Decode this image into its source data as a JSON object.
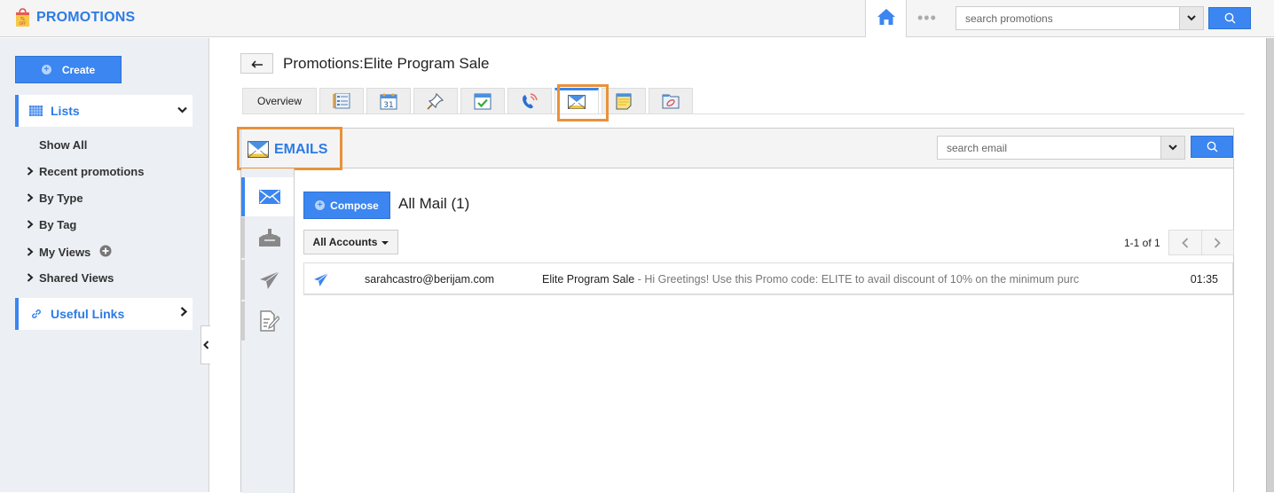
{
  "app": {
    "title": "PROMOTIONS",
    "icon": "shopping-bag-icon",
    "brand_color": "#2d7be5"
  },
  "topbar": {
    "home_icon": "home-icon",
    "more_icon": "more-dots-icon",
    "search_placeholder": "search promotions",
    "search_icon": "search-icon"
  },
  "sidebar": {
    "create_label": "Create",
    "lists_label": "Lists",
    "items": [
      {
        "label": "Show All",
        "has_arrow": false
      },
      {
        "label": "Recent promotions",
        "has_arrow": true
      },
      {
        "label": "By Type",
        "has_arrow": true
      },
      {
        "label": "By Tag",
        "has_arrow": true
      },
      {
        "label": "My Views",
        "has_arrow": true,
        "has_add": true
      },
      {
        "label": "Shared Views",
        "has_arrow": true
      }
    ],
    "useful_links_label": "Useful Links"
  },
  "header": {
    "back_icon": "back-arrow-icon",
    "title": "Promotions:Elite Program Sale"
  },
  "tabs": [
    {
      "label": "Overview",
      "icon": null
    },
    {
      "label": "",
      "icon": "details-icon"
    },
    {
      "label": "",
      "icon": "calendar-icon",
      "text": "31"
    },
    {
      "label": "",
      "icon": "pin-icon"
    },
    {
      "label": "",
      "icon": "task-check-icon"
    },
    {
      "label": "",
      "icon": "phone-call-icon"
    },
    {
      "label": "",
      "icon": "email-icon",
      "active": true
    },
    {
      "label": "",
      "icon": "notes-icon"
    },
    {
      "label": "",
      "icon": "attachment-folder-icon"
    }
  ],
  "emails": {
    "section_title": "EMAILS",
    "search_placeholder": "search email",
    "side_tabs": [
      "all-mail-icon",
      "inbox-icon",
      "sent-icon",
      "drafts-icon"
    ],
    "compose_label": "Compose",
    "folder_title": "All Mail (1)",
    "accounts_label": "All Accounts",
    "pager_text": "1-1 of 1",
    "messages": [
      {
        "icon": "sent-icon",
        "from": "sarahcastro@berijam.com",
        "subject": "Elite Program Sale",
        "snippet": " - Hi Greetings! Use this Promo code: ELITE to avail discount of 10% on the minimum purc",
        "time": "01:35"
      }
    ]
  }
}
